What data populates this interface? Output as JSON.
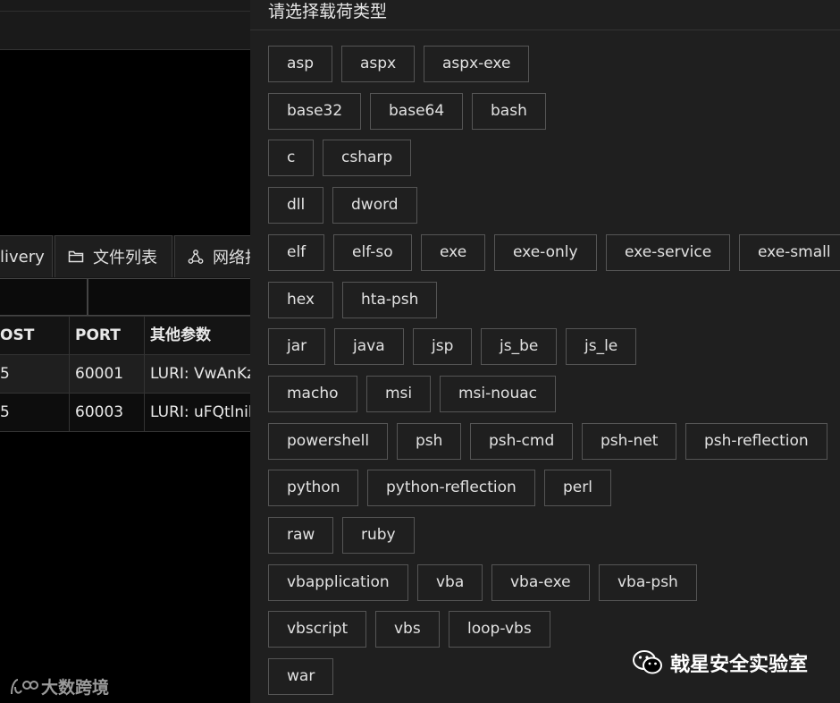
{
  "panel": {
    "title": "请选择载荷类型"
  },
  "payload_types": [
    [
      "asp",
      "aspx",
      "aspx-exe"
    ],
    [
      "base32",
      "base64",
      "bash"
    ],
    [
      "c",
      "csharp"
    ],
    [
      "dll",
      "dword"
    ],
    [
      "elf",
      "elf-so",
      "exe",
      "exe-only",
      "exe-service",
      "exe-small"
    ],
    [
      "hex",
      "hta-psh"
    ],
    [
      "jar",
      "java",
      "jsp",
      "js_be",
      "js_le"
    ],
    [
      "macho",
      "msi",
      "msi-nouac"
    ],
    [
      "powershell",
      "psh",
      "psh-cmd",
      "psh-net",
      "psh-reflection"
    ],
    [
      "python",
      "python-reflection",
      "perl"
    ],
    [
      "raw",
      "ruby"
    ],
    [
      "vbapplication",
      "vba",
      "vba-exe",
      "vba-psh"
    ],
    [
      "vbscript",
      "vbs",
      "loop-vbs"
    ],
    [
      "war"
    ]
  ],
  "tabs": [
    {
      "label": "livery",
      "icon": ""
    },
    {
      "label": "文件列表",
      "icon": "folder-icon"
    },
    {
      "label": "网络拓",
      "icon": "network-icon"
    }
  ],
  "table": {
    "headers": [
      "OST",
      "PORT",
      "其他参数"
    ],
    "rows": [
      [
        "5",
        "60001",
        "LURI: VwAnKz"
      ],
      [
        "5",
        "60003",
        "LURI: uFQtlnib"
      ]
    ]
  },
  "watermarks": {
    "left": "大数跨境",
    "right": "戟星安全实验室"
  }
}
